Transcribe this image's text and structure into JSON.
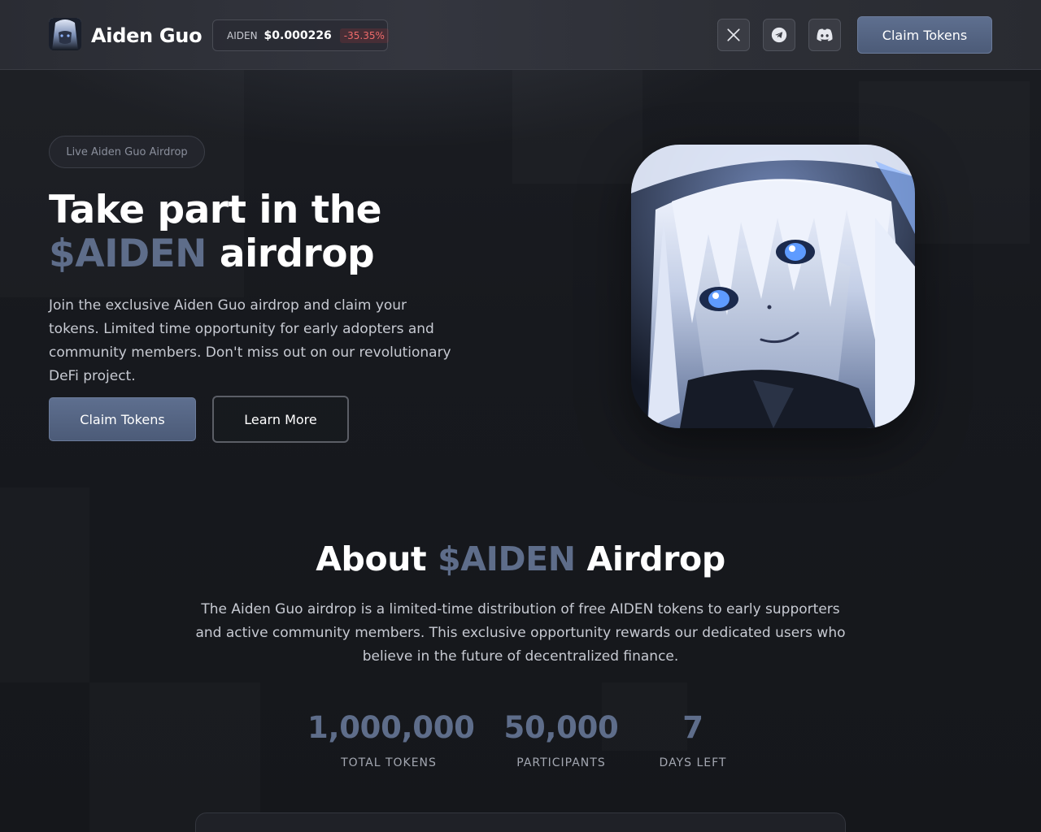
{
  "header": {
    "brand_name": "Aiden Guo",
    "price": {
      "ticker": "AIDEN",
      "value": "$0.000226",
      "change": "-35.35%"
    },
    "socials": [
      {
        "icon": "x-icon"
      },
      {
        "icon": "telegram-icon"
      },
      {
        "icon": "discord-icon"
      }
    ],
    "claim_label": "Claim Tokens"
  },
  "hero": {
    "badge": "Live Aiden Guo Airdrop",
    "title_line1": "Take part in the",
    "title_accent": "$AIDEN",
    "title_rest": " airdrop",
    "description": "Join the exclusive Aiden Guo airdrop and claim your tokens. Limited time opportunity for early adopters and community members. Don't miss out on our revolutionary DeFi project.",
    "primary_label": "Claim Tokens",
    "secondary_label": "Learn More"
  },
  "about": {
    "title_prefix": "About ",
    "title_accent": "$AIDEN",
    "title_suffix": " Airdrop",
    "description": "The Aiden Guo airdrop is a limited-time distribution of free AIDEN tokens to early supporters and active community members. This exclusive opportunity rewards our dedicated users who believe in the future of decentralized finance.",
    "stats": [
      {
        "value": "1,000,000",
        "label": "TOTAL TOKENS"
      },
      {
        "value": "50,000",
        "label": "PARTICIPANTS"
      },
      {
        "value": "7",
        "label": "DAYS LEFT"
      }
    ]
  },
  "colors": {
    "accent": "#5e6d8a",
    "button": "#5b6b8a",
    "background": "#17191e",
    "negative": "#ef6b6b"
  }
}
